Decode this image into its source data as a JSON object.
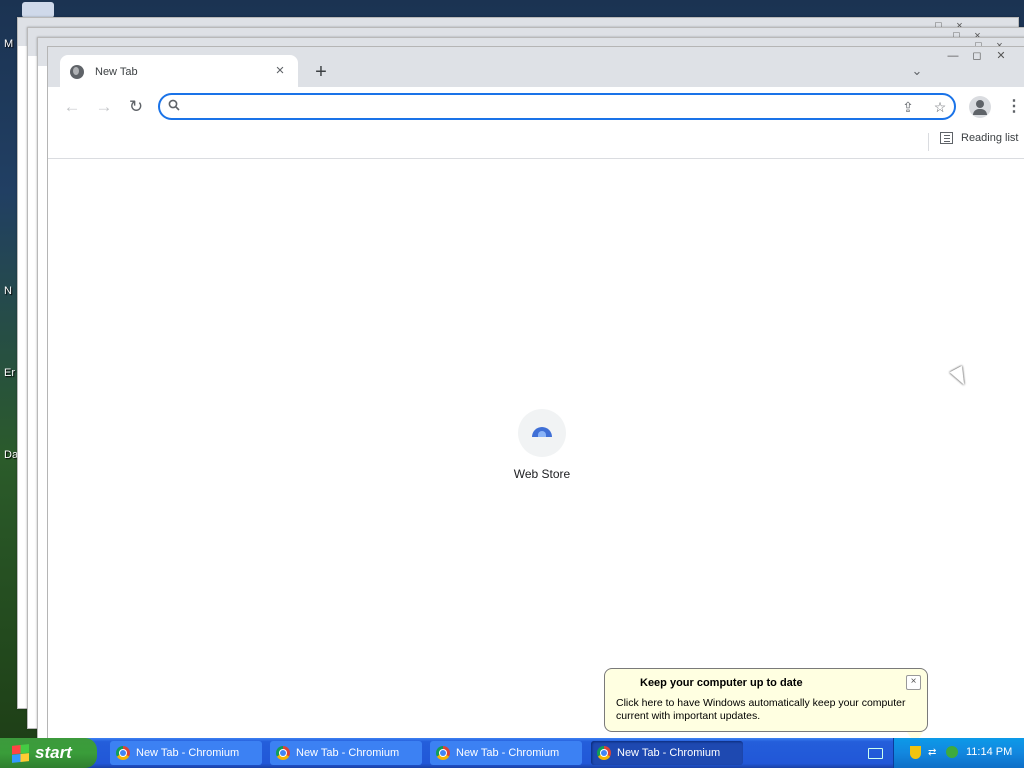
{
  "desktop": {
    "icon_labels": [
      "M",
      "N",
      "Er",
      "Da"
    ]
  },
  "back_windows": {
    "controls": [
      "_",
      "□",
      "×"
    ]
  },
  "browser": {
    "tab": {
      "title": "New Tab",
      "close": "×"
    },
    "new_tab_symbol": "+",
    "tab_search_symbol": "⌄",
    "window_controls": [
      "—",
      "◻",
      "✕"
    ],
    "toolbar": {
      "back": "←",
      "forward": "→",
      "reload": "↻",
      "omnibox_value": "",
      "omnibox_placeholder": "",
      "share_icon": "⇪",
      "bookmark_star": "☆",
      "menu": "⋮"
    },
    "bookmarks_bar": {
      "reading_list_label": "Reading list"
    },
    "new_tab_page": {
      "shortcuts": [
        {
          "label": "Web Store",
          "icon": "webstore-icon"
        }
      ]
    }
  },
  "notification": {
    "title": "Keep your computer up to date",
    "text": "Click here to have Windows automatically keep your computer current with important updates.",
    "close": "×"
  },
  "taskbar": {
    "start_label": "start",
    "tasks": [
      {
        "label": "New Tab - Chromium",
        "active": false
      },
      {
        "label": "New Tab - Chromium",
        "active": false
      },
      {
        "label": "New Tab - Chromium",
        "active": false
      },
      {
        "label": "New Tab - Chromium",
        "active": true
      }
    ],
    "clock": "11:14 PM"
  },
  "colors": {
    "accent": "#1a73e8",
    "tabstrip": "#dee1e6",
    "taskbar": "#245edb",
    "start_button": "#3a9d3a",
    "balloon": "#ffffe1"
  }
}
